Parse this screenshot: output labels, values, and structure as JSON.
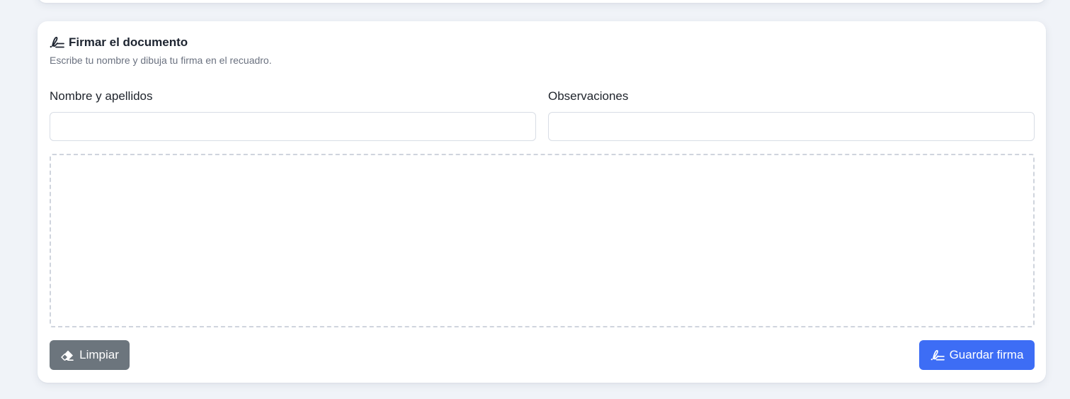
{
  "sign_card": {
    "title": "Firmar el documento",
    "title_icon": "signature-icon",
    "subtitle": "Escribe tu nombre y dibuja tu firma en el recuadro.",
    "fields": {
      "name_label": "Nombre y apellidos",
      "name_value": "",
      "observations_label": "Observaciones",
      "observations_value": ""
    },
    "signature_pad": {
      "border_color": "#cfd4dd"
    },
    "actions": {
      "clear_label": "Limpiar",
      "clear_icon": "eraser-icon",
      "clear_color": "#6c757d",
      "save_label": "Guardar firma",
      "save_icon": "signature-icon",
      "save_color": "#3d6df5"
    }
  }
}
